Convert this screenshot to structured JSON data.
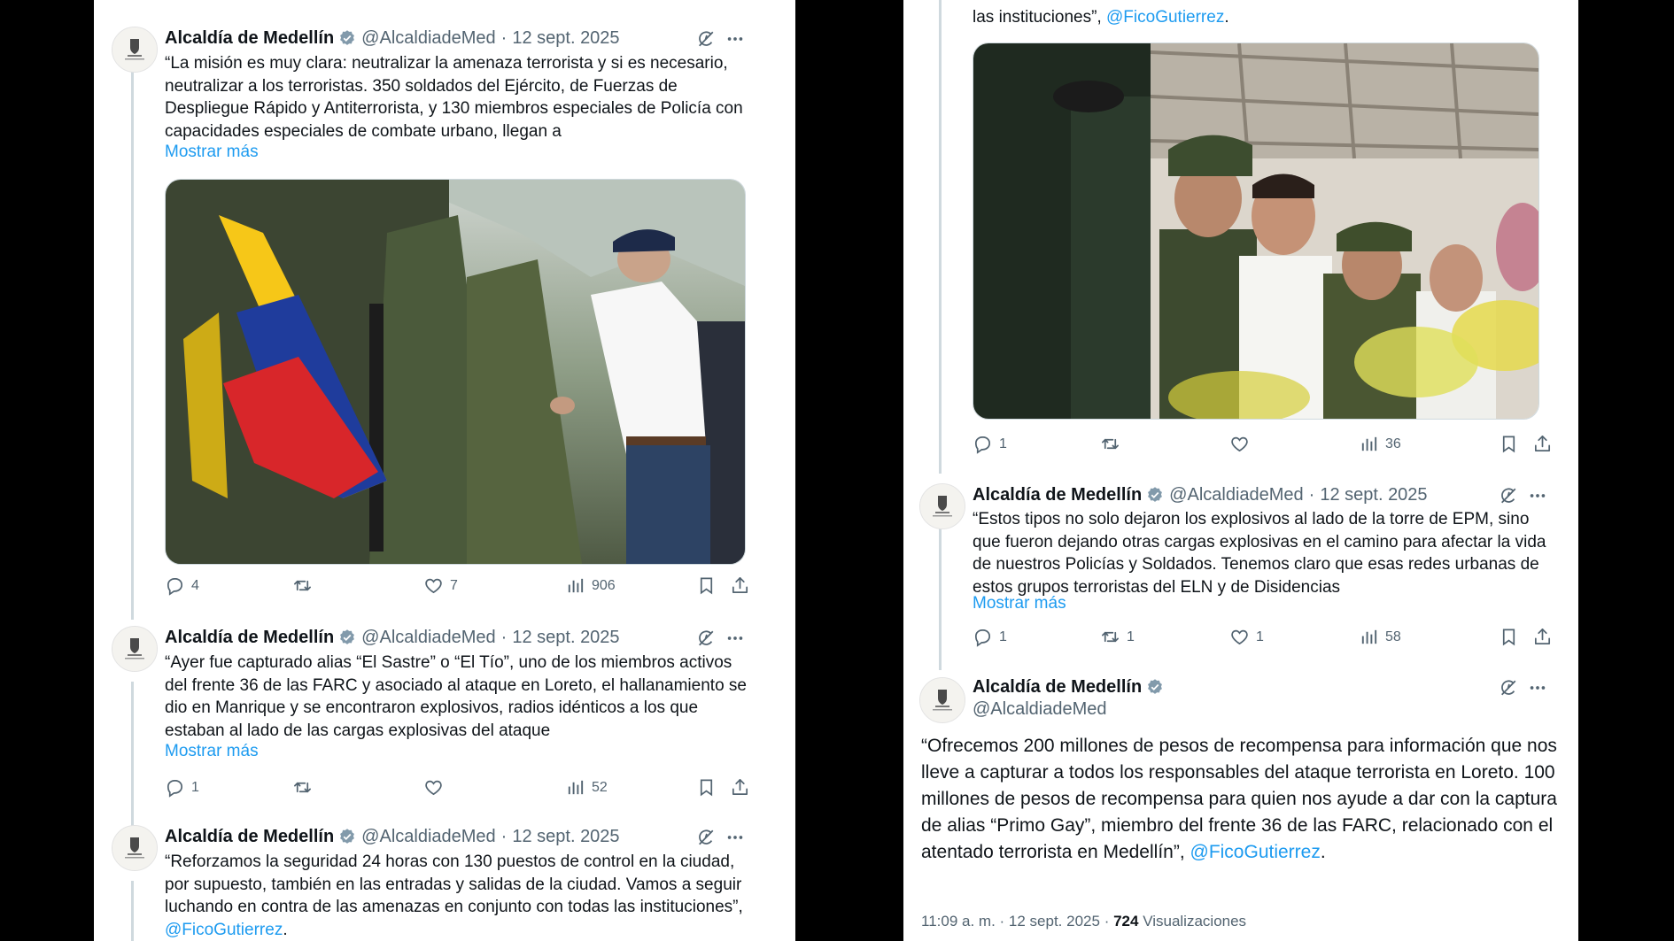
{
  "author": {
    "name": "Alcaldía de Medellín",
    "handle": "@AlcaldiadeMed"
  },
  "left_tweets": [
    {
      "date": "12 sept. 2025",
      "text": "“La misión es muy clara: neutralizar la amenaza terrorista y si es necesario, neutralizar a los terroristas. 350 soldados del Ejército, de Fuerzas de Despliegue Rápido y Antiterrorista, y 130 miembros especiales de Policía con capacidades especiales de combate urbano, llegan a",
      "show_more": "Mostrar más",
      "replies": "4",
      "retweets": "",
      "likes": "7",
      "views": "906"
    },
    {
      "date": "12 sept. 2025",
      "text": "“Ayer fue capturado alias “El Sastre” o “El Tío”, uno de los miembros activos del frente 36 de las FARC y asociado al ataque en Loreto, el hallanamiento se dio en Manrique y se encontraron explosivos, radios idénticos a los que estaban al lado de las cargas explosivas del ataque",
      "show_more": "Mostrar más",
      "replies": "1",
      "retweets": "",
      "likes": "",
      "views": "52"
    },
    {
      "date": "12 sept. 2025",
      "text": "“Reforzamos la seguridad 24 horas con 130 puestos de control en la ciudad, por supuesto, también en las entradas y salidas de la ciudad. Vamos a seguir luchando en contra de las amenazas en conjunto con todas las instituciones”, ",
      "mention": "@FicoGutierrez",
      "tail": "."
    }
  ],
  "right_top": {
    "text": "las instituciones”, ",
    "mention": "@FicoGutierrez",
    "tail": ".",
    "replies": "1",
    "retweets": "",
    "likes": "",
    "views": "36"
  },
  "right_tweets": [
    {
      "date": "12 sept. 2025",
      "text": "“Estos tipos no solo dejaron los explosivos al lado de la torre de EPM, sino que fueron dejando otras cargas explosivas en el camino para afectar la vida de nuestros Policías y Soldados. Tenemos claro que esas redes urbanas de estos grupos terroristas del ELN y de Disidencias",
      "show_more": "Mostrar más",
      "replies": "1",
      "retweets": "1",
      "likes": "1",
      "views": "58"
    }
  ],
  "main_tweet": {
    "text": "“Ofrecemos 200 millones de pesos de recompensa para información que nos lleve a capturar a todos los responsables del ataque terrorista en Loreto. 100 millones de pesos de recompensa para quien nos ayude a dar con la captura de alias “Primo Gay”, miembro del frente 36 de las FARC, relacionado con el atentado terrorista en Medellín”, ",
    "mention": "@FicoGutierrez",
    "tail": ".",
    "time": "11:09 a. m.",
    "date": "12 sept. 2025",
    "views_count": "724",
    "views_label": "Visualizaciones"
  },
  "colors": {
    "accent": "#1d9bf0",
    "muted": "#536471",
    "text": "#0f1419",
    "badge": "#829aab"
  },
  "icons": [
    "verified-badge-icon",
    "grok-icon",
    "more-icon",
    "reply-icon",
    "retweet-icon",
    "like-icon",
    "views-icon",
    "bookmark-icon",
    "share-icon"
  ]
}
